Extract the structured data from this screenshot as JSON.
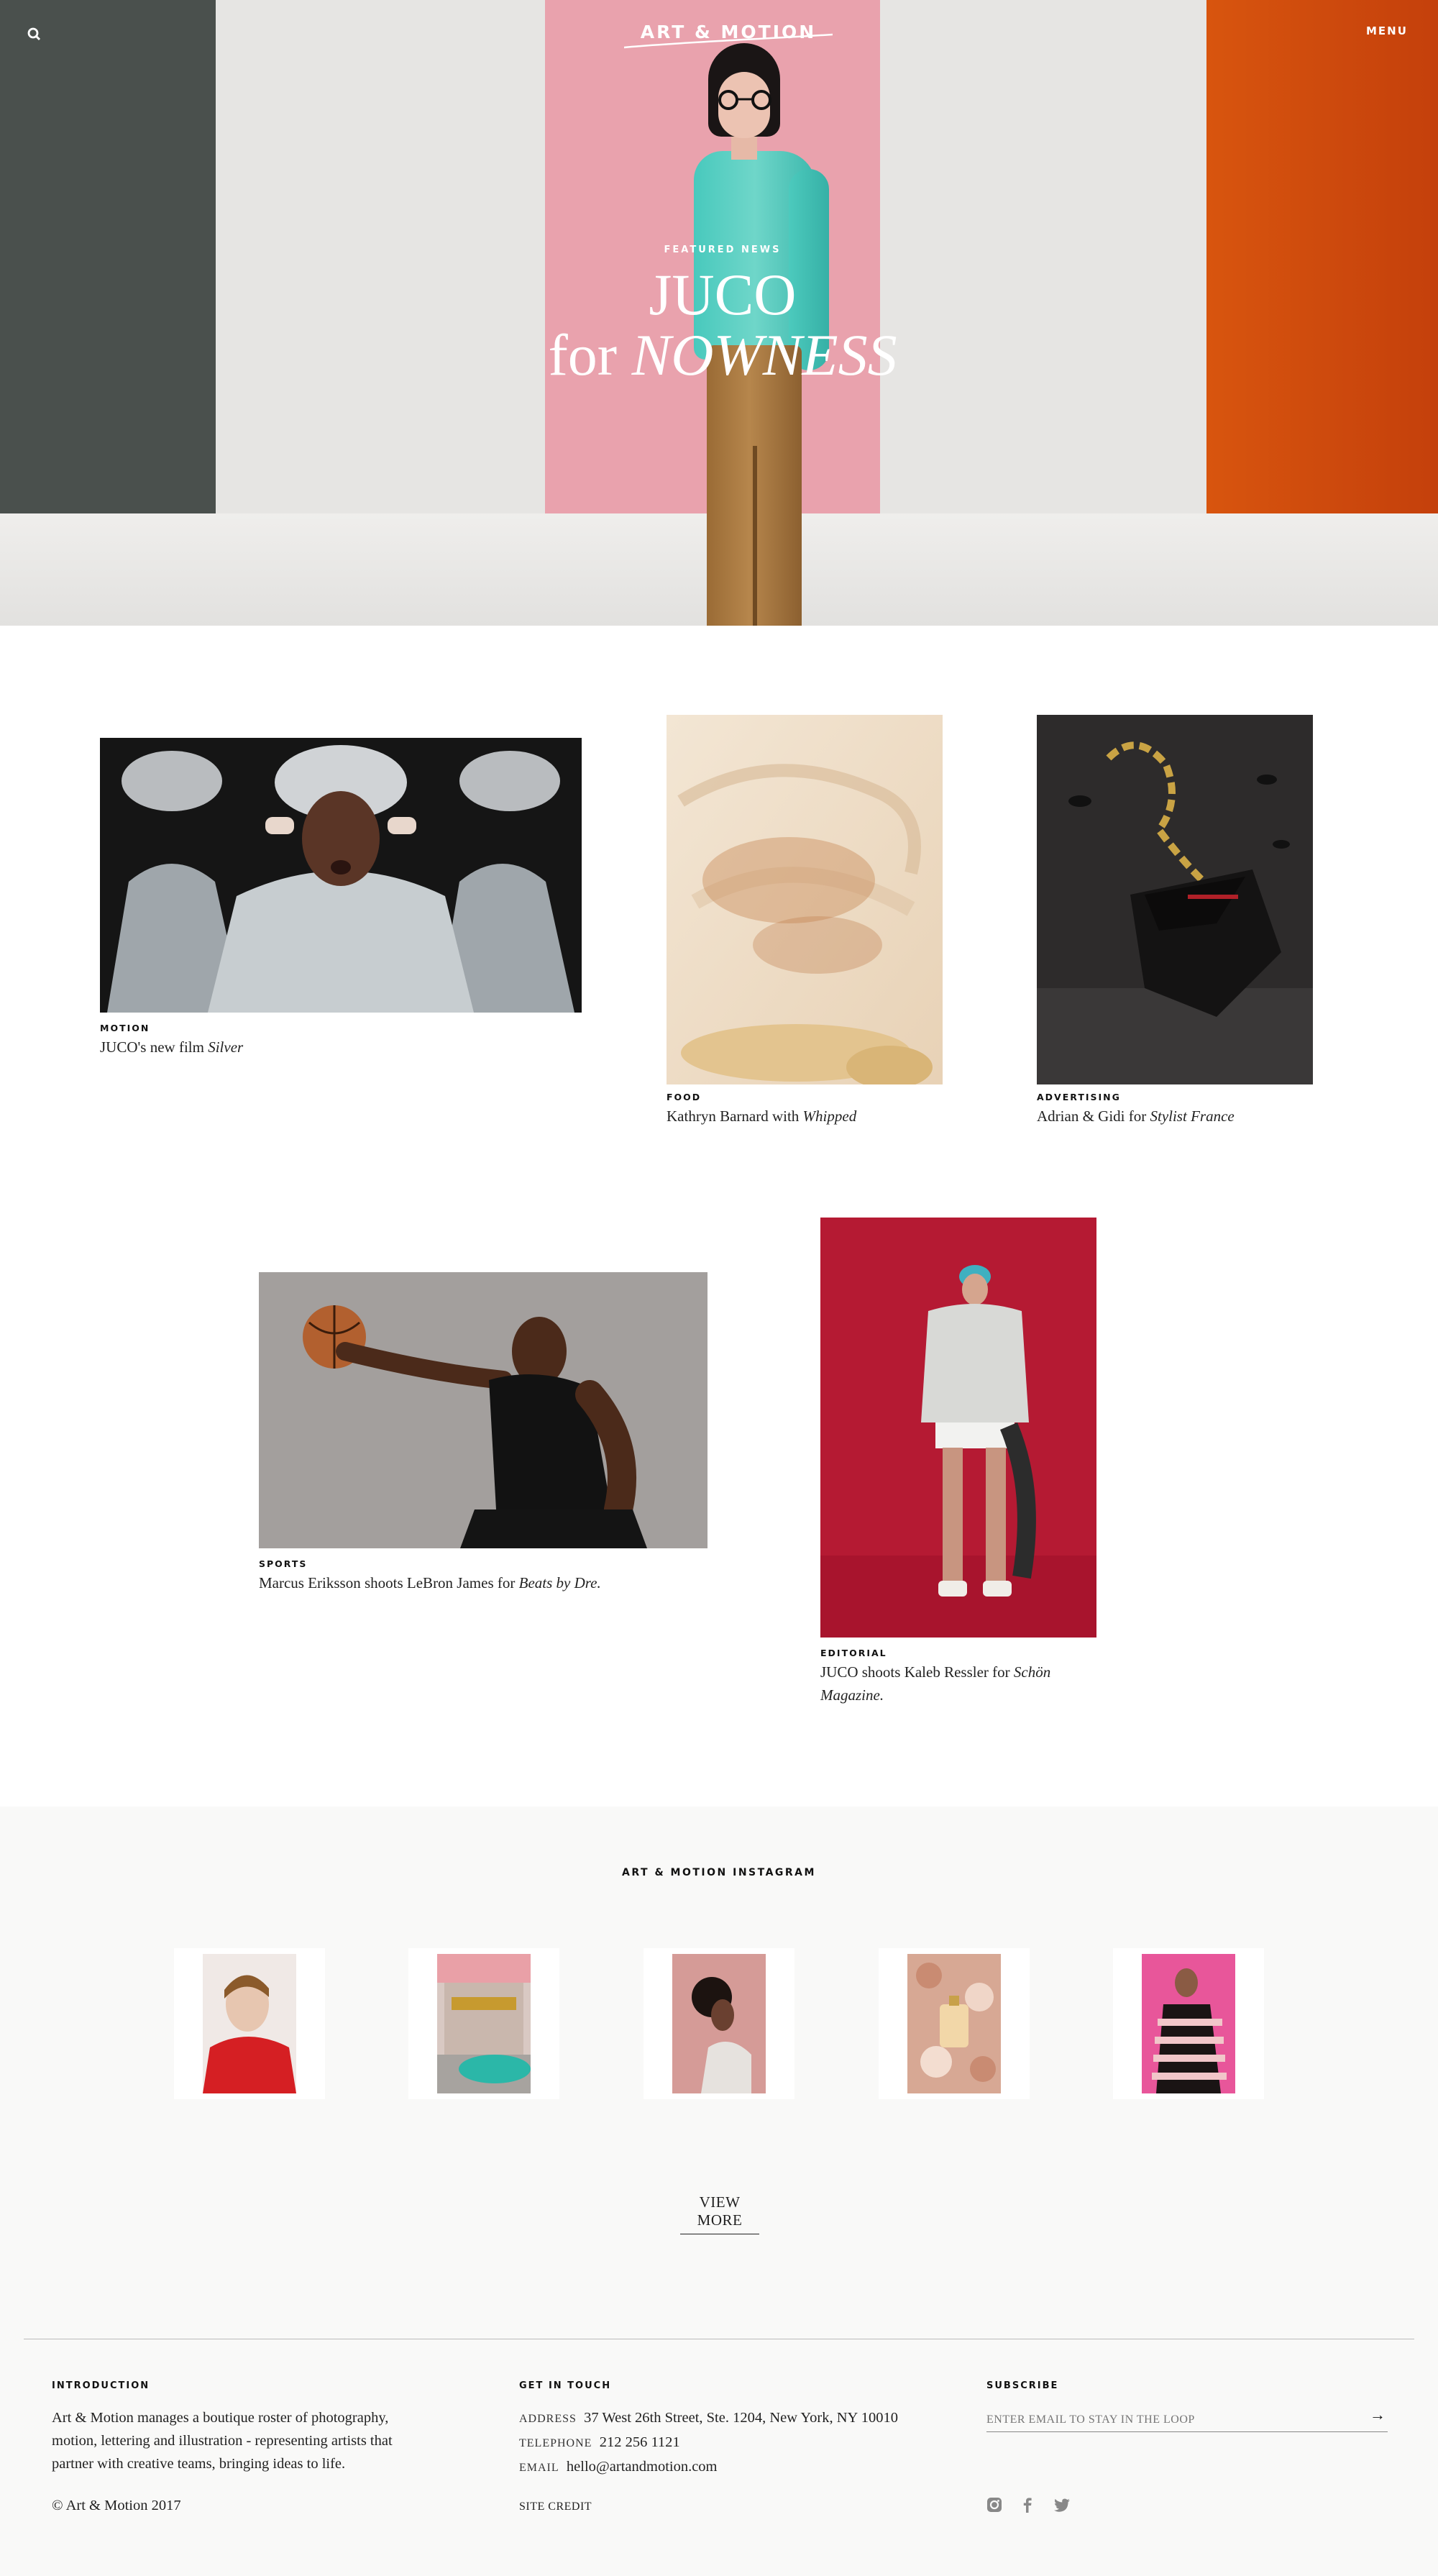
{
  "header": {
    "logo": "ART & MOTION",
    "menu_label": "MENU",
    "search_icon": "search-icon"
  },
  "hero": {
    "kicker": "FEATURED NEWS",
    "title_line1": "JUCO",
    "title_for": "for ",
    "title_italic": "NOWNESS"
  },
  "posts": [
    {
      "category": "MOTION",
      "caption": "JUCO's new film ",
      "caption_italic": "Silver"
    },
    {
      "category": "FOOD",
      "caption": "Kathryn Barnard with ",
      "caption_italic": "Whipped"
    },
    {
      "category": "ADVERTISING",
      "caption": "Adrian & Gidi for ",
      "caption_italic": "Stylist France"
    },
    {
      "category": "SPORTS",
      "caption": "Marcus Eriksson shoots LeBron James for ",
      "caption_italic": "Beats by Dre."
    },
    {
      "category": "EDITORIAL",
      "caption": "JUCO shoots Kaleb Ressler for ",
      "caption_italic": "Schön",
      "caption_line2": "Magazine."
    }
  ],
  "instagram": {
    "title": "ART & MOTION INSTAGRAM",
    "view_more": "VIEW MORE"
  },
  "footer": {
    "intro_heading": "INTRODUCTION",
    "intro_text": [
      "Art & Motion manages a boutique roster of photography,",
      "motion, lettering and illustration - representing artists that",
      "partner with creative teams, bringing ideas to life."
    ],
    "copyright": "© Art & Motion 2017",
    "contact_heading": "GET IN TOUCH",
    "address_label": "ADDRESS",
    "address": "37 West 26th Street, Ste. 1204, New York, NY 10010",
    "telephone_label": "TELEPHONE",
    "telephone": "212 256 1121",
    "email_label": "EMAIL",
    "email": "hello@artandmotion.com",
    "site_credit": "SITE CREDIT",
    "subscribe_heading": "SUBSCRIBE",
    "subscribe_placeholder": "ENTER EMAIL TO STAY IN THE LOOP",
    "subscribe_arrow": "→",
    "social_icons": [
      "instagram-icon",
      "facebook-icon",
      "twitter-icon"
    ]
  }
}
